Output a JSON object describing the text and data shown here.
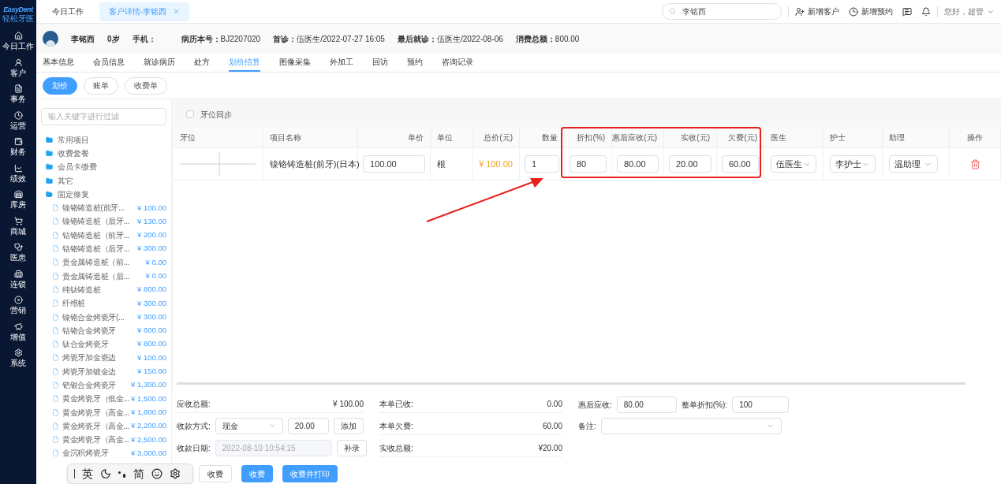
{
  "brand": {
    "name": "EasyDent",
    "subtitle": "轻松牙医"
  },
  "nav": [
    {
      "label": "今日工作"
    },
    {
      "label": "客户"
    },
    {
      "label": "事务"
    },
    {
      "label": "运营"
    },
    {
      "label": "财务"
    },
    {
      "label": "绩效"
    },
    {
      "label": "库房"
    },
    {
      "label": "商城"
    },
    {
      "label": "医患"
    },
    {
      "label": "连锁"
    },
    {
      "label": "营销"
    },
    {
      "label": "增值"
    },
    {
      "label": "系统"
    }
  ],
  "page_tabs": [
    {
      "label": "今日工作",
      "selected": false,
      "closable": false
    },
    {
      "label": "客户详情-李铭西",
      "selected": true,
      "closable": true
    }
  ],
  "search": {
    "value": "李铭西"
  },
  "actions": [
    "新增客户",
    "新增预约"
  ],
  "greeting": "您好，超管",
  "patient": {
    "name": "李铭西",
    "age": "0岁",
    "phone_label": "手机：",
    "info": [
      {
        "label": "病历本号：",
        "value": "BJ2207020"
      },
      {
        "label": "首诊：",
        "value": "伍医生/2022-07-27 16:05"
      },
      {
        "label": "最后就诊：",
        "value": "伍医生/2022-08-06"
      },
      {
        "label": "消费总额：",
        "value": "800.00"
      }
    ]
  },
  "detail_tabs": [
    {
      "label": "基本信息",
      "selected": false
    },
    {
      "label": "会员信息",
      "selected": false
    },
    {
      "label": "就诊病历",
      "selected": false
    },
    {
      "label": "处方",
      "selected": false
    },
    {
      "label": "划价结算",
      "selected": true
    },
    {
      "label": "图像采集",
      "selected": false
    },
    {
      "label": "外加工",
      "selected": false
    },
    {
      "label": "回访",
      "selected": false
    },
    {
      "label": "预约",
      "selected": false
    },
    {
      "label": "咨询记录",
      "selected": false
    }
  ],
  "sub_buttons": [
    {
      "label": "划价",
      "selected": true
    },
    {
      "label": "账单",
      "selected": false
    },
    {
      "label": "收费单",
      "selected": false
    }
  ],
  "filter": {
    "placeholder": "输入关键字进行过滤"
  },
  "tree": [
    {
      "label": "常用项目",
      "expanded": false
    },
    {
      "label": "收费套餐",
      "expanded": false
    },
    {
      "label": "会员卡缴费",
      "expanded": false
    },
    {
      "label": "其它",
      "expanded": false
    },
    {
      "label": "固定修复",
      "expanded": true,
      "children": [
        {
          "label": "镍铬铸造桩(前牙...",
          "price": "¥ 100.00"
        },
        {
          "label": "镍铬铸造桩（后牙...",
          "price": "¥ 130.00"
        },
        {
          "label": "钴铬铸造桩（前牙...",
          "price": "¥ 200.00"
        },
        {
          "label": "钴铬铸造桩（后牙...",
          "price": "¥ 300.00"
        },
        {
          "label": "贵金属铸造桩（前...",
          "price": "¥ 0.00"
        },
        {
          "label": "贵金属铸造桩（后...",
          "price": "¥ 0.00"
        },
        {
          "label": "纯钛铸造桩",
          "price": "¥ 800.00"
        },
        {
          "label": "纤维桩",
          "price": "¥ 300.00"
        },
        {
          "label": "镍铬合金烤瓷牙(...",
          "price": "¥ 300.00"
        },
        {
          "label": "钴铬合金烤瓷牙",
          "price": "¥ 600.00"
        },
        {
          "label": "钛合金烤瓷牙",
          "price": "¥ 800.00"
        },
        {
          "label": "烤瓷牙加金瓷边",
          "price": "¥ 100.00"
        },
        {
          "label": "烤瓷牙加镀金边",
          "price": "¥ 150.00"
        },
        {
          "label": "钯银合金烤瓷牙",
          "price": "¥ 1,300.00"
        },
        {
          "label": "黄金烤瓷牙（低金...",
          "price": "¥ 1,500.00"
        },
        {
          "label": "黄金烤瓷牙（高金...",
          "price": "¥ 1,800.00"
        },
        {
          "label": "黄金烤瓷牙（高金...",
          "price": "¥ 2,200.00"
        },
        {
          "label": "黄金烤瓷牙（高金...",
          "price": "¥ 2,500.00"
        },
        {
          "label": "金沉积烤瓷牙",
          "price": "¥ 3,000.00"
        }
      ]
    }
  ],
  "tooth_sync": {
    "label": "牙位同步",
    "checked": false
  },
  "table": {
    "columns": [
      {
        "label": "牙位",
        "kind": "tooth"
      },
      {
        "label": "项目名称",
        "kind": "text"
      },
      {
        "label": "单价",
        "kind": "input"
      },
      {
        "label": "单位",
        "kind": "text"
      },
      {
        "label": "总价(元)",
        "kind": "price"
      },
      {
        "label": "数量",
        "kind": "input"
      },
      {
        "label": "折扣(%)",
        "kind": "input"
      },
      {
        "label": "惠后应收(元)",
        "kind": "input"
      },
      {
        "label": "实收(元)",
        "kind": "input"
      },
      {
        "label": "欠费(元)",
        "kind": "input"
      },
      {
        "label": "医生",
        "kind": "select"
      },
      {
        "label": "护士",
        "kind": "select"
      },
      {
        "label": "助理",
        "kind": "select"
      },
      {
        "label": "操作",
        "kind": "delete"
      }
    ],
    "rows": [
      {
        "cells": [
          "",
          "镍铬铸造桩(前牙)(日本)",
          "100.00",
          "根",
          "¥ 100.00",
          "1",
          "80",
          "80.00",
          "20.00",
          "60.00",
          "伍医生",
          "李护士",
          "温助理",
          ""
        ]
      }
    ]
  },
  "summary": {
    "total_label": "应收总额:",
    "total": "¥ 100.00",
    "method_label": "收款方式:",
    "method": "现金",
    "amount": "20.00",
    "add_button": "添加",
    "date_label": "收款日期:",
    "date": "2022-08-10 10:54:15",
    "supplement_button": "补录",
    "buttons": [
      {
        "label": "收费",
        "primary": false
      },
      {
        "label": "收费",
        "primary": true
      },
      {
        "label": "收费并打印",
        "primary": true
      }
    ],
    "stats": [
      {
        "label": "本单已收:",
        "value": "0.00"
      },
      {
        "label": "本单欠费:",
        "value": "60.00"
      },
      {
        "label": "实收总额:",
        "value": "¥20.00"
      }
    ],
    "after_label": "惠后应收:",
    "after": "80.00",
    "discount_label": "整单折扣(%):",
    "discount": "100",
    "remark_label": "备注:"
  },
  "ime_bar": {
    "labels": [
      "英",
      "简"
    ]
  }
}
